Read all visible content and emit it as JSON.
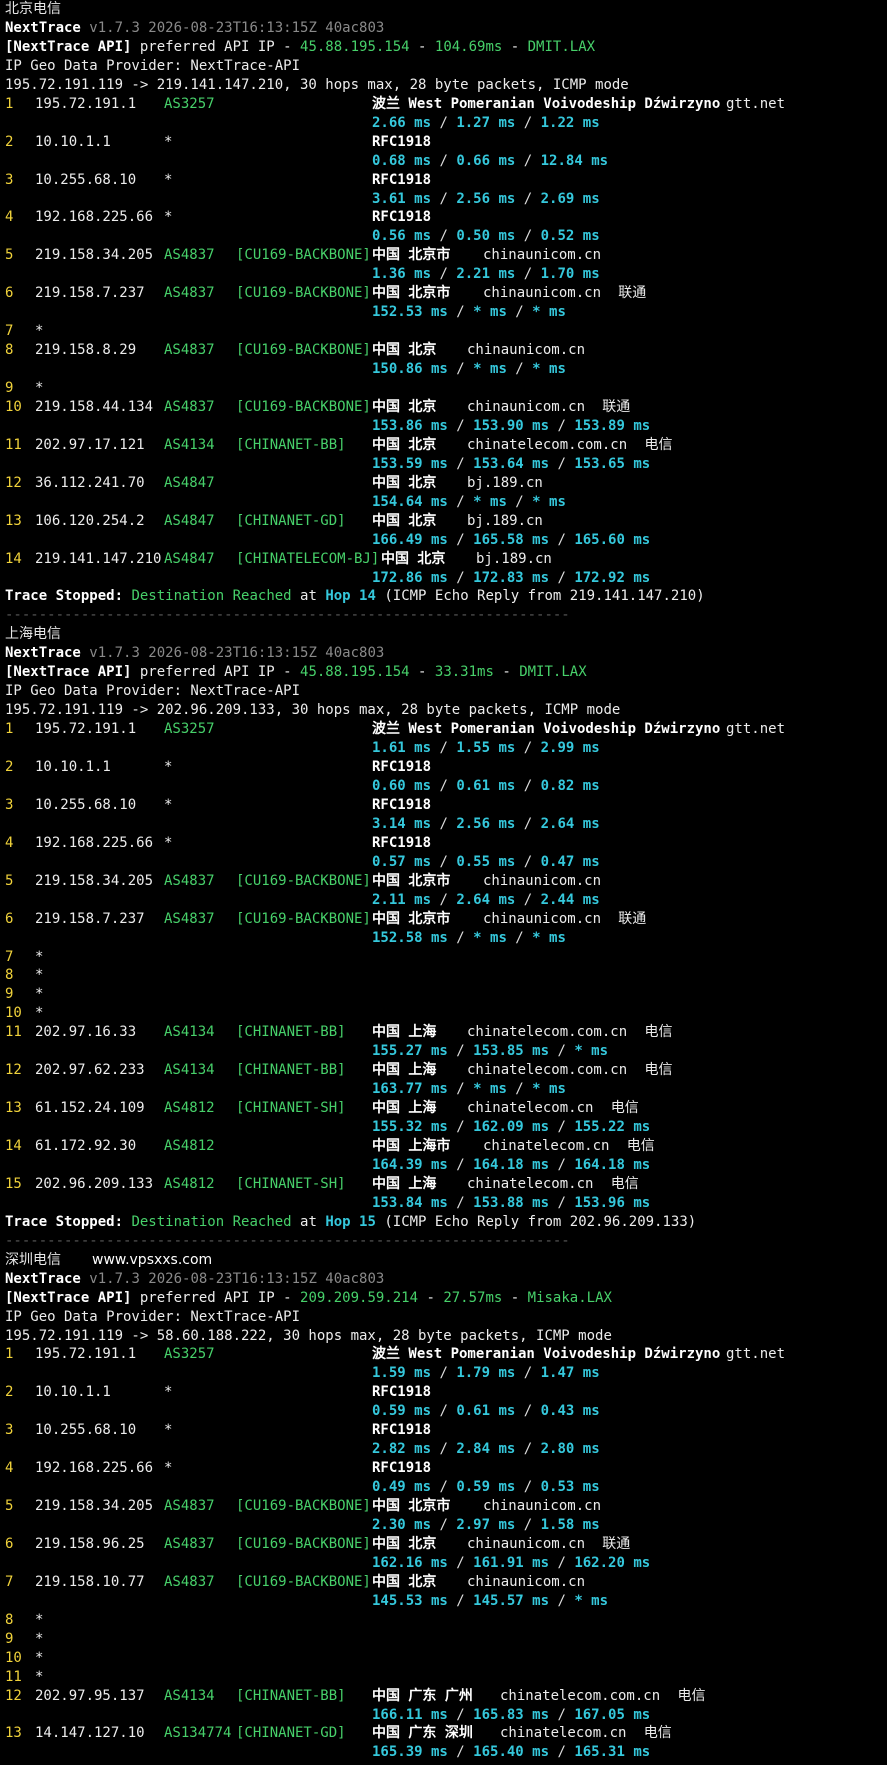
{
  "watermark": "www.vpsxxs.com",
  "separator": "-------------------------------------------------------------------",
  "sections": [
    {
      "title": "北京电信",
      "version_line": {
        "app": "NextTrace",
        "meta": "v1.7.3 2026-08-23T16:13:15Z 40ac803"
      },
      "api_line": {
        "tag": "[NextTrace API]",
        "text": " preferred API IP - ",
        "ip": "45.88.195.154",
        "sep1": " - ",
        "latency": "104.69ms",
        "sep2": " - ",
        "node": "DMIT.LAX"
      },
      "provider_line": "IP Geo Data Provider: NextTrace-API",
      "route_line": "195.72.191.119 -> 219.141.147.210, 30 hops max, 28 byte packets, ICMP mode",
      "hops": [
        {
          "num": "1",
          "ip": "195.72.191.1",
          "asn": "AS3257",
          "tag": "",
          "geo": "波兰 West Pomeranian Voivodeship Dźwirzyno",
          "domain": "gtt.net",
          "isp": "",
          "t1": "2.66 ms",
          "t2": "1.27 ms",
          "t3": "1.22 ms"
        },
        {
          "num": "2",
          "ip": "10.10.1.1",
          "asn": "*",
          "tag": "",
          "geo": "RFC1918",
          "domain": "",
          "isp": "",
          "t1": "0.68 ms",
          "t2": "0.66 ms",
          "t3": "12.84 ms"
        },
        {
          "num": "3",
          "ip": "10.255.68.10",
          "asn": "*",
          "tag": "",
          "geo": "RFC1918",
          "domain": "",
          "isp": "",
          "t1": "3.61 ms",
          "t2": "2.56 ms",
          "t3": "2.69 ms"
        },
        {
          "num": "4",
          "ip": "192.168.225.66",
          "asn": "*",
          "tag": "",
          "geo": "RFC1918",
          "domain": "",
          "isp": "",
          "t1": "0.56 ms",
          "t2": "0.50 ms",
          "t3": "0.52 ms"
        },
        {
          "num": "5",
          "ip": "219.158.34.205",
          "asn": "AS4837",
          "tag": "[CU169-BACKBONE]",
          "geo": "中国 北京市",
          "domain": "chinaunicom.cn",
          "isp": "",
          "t1": "1.36 ms",
          "t2": "2.21 ms",
          "t3": "1.70 ms"
        },
        {
          "num": "6",
          "ip": "219.158.7.237",
          "asn": "AS4837",
          "tag": "[CU169-BACKBONE]",
          "geo": "中国 北京市",
          "domain": "chinaunicom.cn",
          "isp": "联通",
          "t1": "152.53 ms",
          "t2": "* ms",
          "t3": "* ms"
        },
        {
          "num": "7",
          "ip": "*",
          "asn": "",
          "tag": "",
          "geo": "",
          "domain": "",
          "isp": "",
          "t1": "",
          "t2": "",
          "t3": ""
        },
        {
          "num": "8",
          "ip": "219.158.8.29",
          "asn": "AS4837",
          "tag": "[CU169-BACKBONE]",
          "geo": "中国 北京",
          "domain": "chinaunicom.cn",
          "isp": "",
          "t1": "150.86 ms",
          "t2": "* ms",
          "t3": "* ms"
        },
        {
          "num": "9",
          "ip": "*",
          "asn": "",
          "tag": "",
          "geo": "",
          "domain": "",
          "isp": "",
          "t1": "",
          "t2": "",
          "t3": ""
        },
        {
          "num": "10",
          "ip": "219.158.44.134",
          "asn": "AS4837",
          "tag": "[CU169-BACKBONE]",
          "geo": "中国 北京",
          "domain": "chinaunicom.cn",
          "isp": "联通",
          "t1": "153.86 ms",
          "t2": "153.90 ms",
          "t3": "153.89 ms"
        },
        {
          "num": "11",
          "ip": "202.97.17.121",
          "asn": "AS4134",
          "tag": "[CHINANET-BB]",
          "geo": "中国 北京",
          "domain": "chinatelecom.com.cn",
          "isp": "电信",
          "t1": "153.59 ms",
          "t2": "153.64 ms",
          "t3": "153.65 ms"
        },
        {
          "num": "12",
          "ip": "36.112.241.70",
          "asn": "AS4847",
          "tag": "",
          "geo": "中国 北京",
          "domain": "bj.189.cn",
          "isp": "",
          "t1": "154.64 ms",
          "t2": "* ms",
          "t3": "* ms"
        },
        {
          "num": "13",
          "ip": "106.120.254.2",
          "asn": "AS4847",
          "tag": "[CHINANET-GD]",
          "geo": "中国 北京",
          "domain": "bj.189.cn",
          "isp": "",
          "t1": "166.49 ms",
          "t2": "165.58 ms",
          "t3": "165.60 ms"
        },
        {
          "num": "14",
          "ip": "219.141.147.210",
          "asn": "AS4847",
          "tag": "[CHINATELECOM-BJ]",
          "geo": "中国 北京",
          "domain": "bj.189.cn",
          "isp": "",
          "t1": "172.86 ms",
          "t2": "172.83 ms",
          "t3": "172.92 ms"
        }
      ],
      "stop": {
        "label": "Trace Stopped:",
        "reached": "Destination Reached",
        "at": " at ",
        "hop": "Hop 14",
        "tail": " (ICMP Echo Reply from 219.141.147.210)"
      }
    },
    {
      "title": "上海电信",
      "version_line": {
        "app": "NextTrace",
        "meta": "v1.7.3 2026-08-23T16:13:15Z 40ac803"
      },
      "api_line": {
        "tag": "[NextTrace API]",
        "text": " preferred API IP - ",
        "ip": "45.88.195.154",
        "sep1": " - ",
        "latency": "33.31ms",
        "sep2": " - ",
        "node": "DMIT.LAX"
      },
      "provider_line": "IP Geo Data Provider: NextTrace-API",
      "route_line": "195.72.191.119 -> 202.96.209.133, 30 hops max, 28 byte packets, ICMP mode",
      "hops": [
        {
          "num": "1",
          "ip": "195.72.191.1",
          "asn": "AS3257",
          "tag": "",
          "geo": "波兰 West Pomeranian Voivodeship Dźwirzyno",
          "domain": "gtt.net",
          "isp": "",
          "t1": "1.61 ms",
          "t2": "1.55 ms",
          "t3": "2.99 ms"
        },
        {
          "num": "2",
          "ip": "10.10.1.1",
          "asn": "*",
          "tag": "",
          "geo": "RFC1918",
          "domain": "",
          "isp": "",
          "t1": "0.60 ms",
          "t2": "0.61 ms",
          "t3": "0.82 ms"
        },
        {
          "num": "3",
          "ip": "10.255.68.10",
          "asn": "*",
          "tag": "",
          "geo": "RFC1918",
          "domain": "",
          "isp": "",
          "t1": "3.14 ms",
          "t2": "2.56 ms",
          "t3": "2.64 ms"
        },
        {
          "num": "4",
          "ip": "192.168.225.66",
          "asn": "*",
          "tag": "",
          "geo": "RFC1918",
          "domain": "",
          "isp": "",
          "t1": "0.57 ms",
          "t2": "0.55 ms",
          "t3": "0.47 ms"
        },
        {
          "num": "5",
          "ip": "219.158.34.205",
          "asn": "AS4837",
          "tag": "[CU169-BACKBONE]",
          "geo": "中国 北京市",
          "domain": "chinaunicom.cn",
          "isp": "",
          "t1": "2.11 ms",
          "t2": "2.64 ms",
          "t3": "2.44 ms"
        },
        {
          "num": "6",
          "ip": "219.158.7.237",
          "asn": "AS4837",
          "tag": "[CU169-BACKBONE]",
          "geo": "中国 北京市",
          "domain": "chinaunicom.cn",
          "isp": "联通",
          "t1": "152.58 ms",
          "t2": "* ms",
          "t3": "* ms"
        },
        {
          "num": "7",
          "ip": "*",
          "asn": "",
          "tag": "",
          "geo": "",
          "domain": "",
          "isp": "",
          "t1": "",
          "t2": "",
          "t3": ""
        },
        {
          "num": "8",
          "ip": "*",
          "asn": "",
          "tag": "",
          "geo": "",
          "domain": "",
          "isp": "",
          "t1": "",
          "t2": "",
          "t3": ""
        },
        {
          "num": "9",
          "ip": "*",
          "asn": "",
          "tag": "",
          "geo": "",
          "domain": "",
          "isp": "",
          "t1": "",
          "t2": "",
          "t3": ""
        },
        {
          "num": "10",
          "ip": "*",
          "asn": "",
          "tag": "",
          "geo": "",
          "domain": "",
          "isp": "",
          "t1": "",
          "t2": "",
          "t3": ""
        },
        {
          "num": "11",
          "ip": "202.97.16.33",
          "asn": "AS4134",
          "tag": "[CHINANET-BB]",
          "geo": "中国 上海",
          "domain": "chinatelecom.com.cn",
          "isp": "电信",
          "t1": "155.27 ms",
          "t2": "153.85 ms",
          "t3": "* ms"
        },
        {
          "num": "12",
          "ip": "202.97.62.233",
          "asn": "AS4134",
          "tag": "[CHINANET-BB]",
          "geo": "中国 上海",
          "domain": "chinatelecom.com.cn",
          "isp": "电信",
          "t1": "163.77 ms",
          "t2": "* ms",
          "t3": "* ms"
        },
        {
          "num": "13",
          "ip": "61.152.24.109",
          "asn": "AS4812",
          "tag": "[CHINANET-SH]",
          "geo": "中国 上海",
          "domain": "chinatelecom.cn",
          "isp": "电信",
          "t1": "155.32 ms",
          "t2": "162.09 ms",
          "t3": "155.22 ms"
        },
        {
          "num": "14",
          "ip": "61.172.92.30",
          "asn": "AS4812",
          "tag": "",
          "geo": "中国 上海市",
          "domain": "chinatelecom.cn",
          "isp": "电信",
          "t1": "164.39 ms",
          "t2": "164.18 ms",
          "t3": "164.18 ms"
        },
        {
          "num": "15",
          "ip": "202.96.209.133",
          "asn": "AS4812",
          "tag": "[CHINANET-SH]",
          "geo": "中国 上海",
          "domain": "chinatelecom.cn",
          "isp": "电信",
          "t1": "153.84 ms",
          "t2": "153.88 ms",
          "t3": "153.96 ms"
        }
      ],
      "stop": {
        "label": "Trace Stopped:",
        "reached": "Destination Reached",
        "at": " at ",
        "hop": "Hop 15",
        "tail": " (ICMP Echo Reply from 202.96.209.133)"
      }
    },
    {
      "title": "深圳电信",
      "version_line": {
        "app": "NextTrace",
        "meta": "v1.7.3 2026-08-23T16:13:15Z 40ac803"
      },
      "api_line": {
        "tag": "[NextTrace API]",
        "text": " preferred API IP - ",
        "ip": "209.209.59.214",
        "sep1": " - ",
        "latency": "27.57ms",
        "sep2": " - ",
        "node": "Misaka.LAX"
      },
      "provider_line": "IP Geo Data Provider: NextTrace-API",
      "route_line": "195.72.191.119 -> 58.60.188.222, 30 hops max, 28 byte packets, ICMP mode",
      "hops": [
        {
          "num": "1",
          "ip": "195.72.191.1",
          "asn": "AS3257",
          "tag": "",
          "geo": "波兰 West Pomeranian Voivodeship Dźwirzyno",
          "domain": "gtt.net",
          "isp": "",
          "t1": "1.59 ms",
          "t2": "1.79 ms",
          "t3": "1.47 ms"
        },
        {
          "num": "2",
          "ip": "10.10.1.1",
          "asn": "*",
          "tag": "",
          "geo": "RFC1918",
          "domain": "",
          "isp": "",
          "t1": "0.59 ms",
          "t2": "0.61 ms",
          "t3": "0.43 ms"
        },
        {
          "num": "3",
          "ip": "10.255.68.10",
          "asn": "*",
          "tag": "",
          "geo": "RFC1918",
          "domain": "",
          "isp": "",
          "t1": "2.82 ms",
          "t2": "2.84 ms",
          "t3": "2.80 ms"
        },
        {
          "num": "4",
          "ip": "192.168.225.66",
          "asn": "*",
          "tag": "",
          "geo": "RFC1918",
          "domain": "",
          "isp": "",
          "t1": "0.49 ms",
          "t2": "0.59 ms",
          "t3": "0.53 ms"
        },
        {
          "num": "5",
          "ip": "219.158.34.205",
          "asn": "AS4837",
          "tag": "[CU169-BACKBONE]",
          "geo": "中国 北京市",
          "domain": "chinaunicom.cn",
          "isp": "",
          "t1": "2.30 ms",
          "t2": "2.97 ms",
          "t3": "1.58 ms"
        },
        {
          "num": "6",
          "ip": "219.158.96.25",
          "asn": "AS4837",
          "tag": "[CU169-BACKBONE]",
          "geo": "中国 北京",
          "domain": "chinaunicom.cn",
          "isp": "联通",
          "t1": "162.16 ms",
          "t2": "161.91 ms",
          "t3": "162.20 ms"
        },
        {
          "num": "7",
          "ip": "219.158.10.77",
          "asn": "AS4837",
          "tag": "[CU169-BACKBONE]",
          "geo": "中国 北京",
          "domain": "chinaunicom.cn",
          "isp": "",
          "t1": "145.53 ms",
          "t2": "145.57 ms",
          "t3": "* ms"
        },
        {
          "num": "8",
          "ip": "*",
          "asn": "",
          "tag": "",
          "geo": "",
          "domain": "",
          "isp": "",
          "t1": "",
          "t2": "",
          "t3": ""
        },
        {
          "num": "9",
          "ip": "*",
          "asn": "",
          "tag": "",
          "geo": "",
          "domain": "",
          "isp": "",
          "t1": "",
          "t2": "",
          "t3": ""
        },
        {
          "num": "10",
          "ip": "*",
          "asn": "",
          "tag": "",
          "geo": "",
          "domain": "",
          "isp": "",
          "t1": "",
          "t2": "",
          "t3": ""
        },
        {
          "num": "11",
          "ip": "*",
          "asn": "",
          "tag": "",
          "geo": "",
          "domain": "",
          "isp": "",
          "t1": "",
          "t2": "",
          "t3": ""
        },
        {
          "num": "12",
          "ip": "202.97.95.137",
          "asn": "AS4134",
          "tag": "[CHINANET-BB]",
          "geo": "中国 广东 广州",
          "domain": "chinatelecom.com.cn",
          "isp": "电信",
          "t1": "166.11 ms",
          "t2": "165.83 ms",
          "t3": "167.05 ms"
        },
        {
          "num": "13",
          "ip": "14.147.127.10",
          "asn": "AS134774",
          "tag": "[CHINANET-GD]",
          "geo": "中国 广东 深圳",
          "domain": "chinatelecom.cn",
          "isp": "电信",
          "t1": "165.39 ms",
          "t2": "165.40 ms",
          "t3": "165.31 ms"
        }
      ],
      "stop": null
    }
  ]
}
